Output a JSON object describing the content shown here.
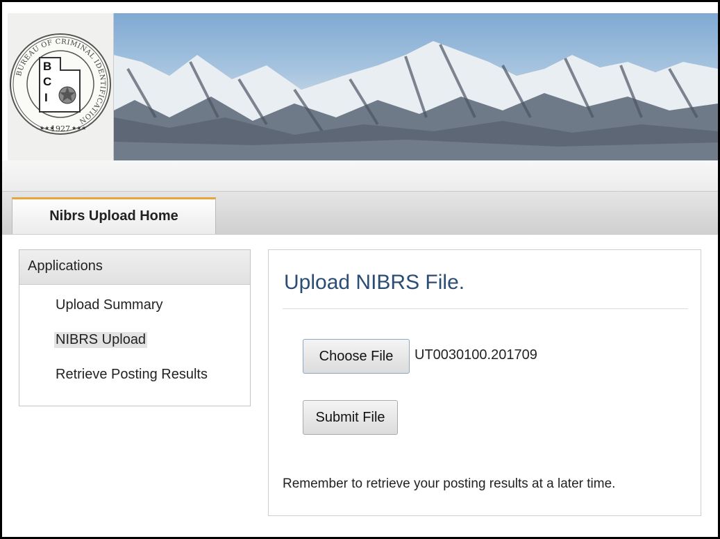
{
  "header": {
    "logo": {
      "icon": "bci-seal-icon",
      "ring_text": "BUREAU OF CRIMINAL IDENTIFICATION",
      "letters": [
        "B",
        "C",
        "I"
      ],
      "year": "1927"
    },
    "banner_icon": "mountain-banner-image"
  },
  "tabs": [
    {
      "label": "Nibrs Upload Home",
      "active": true
    }
  ],
  "sidebar": {
    "header": "Applications",
    "items": [
      {
        "label": "Upload Summary",
        "selected": false
      },
      {
        "label": "NIBRS Upload",
        "selected": true
      },
      {
        "label": "Retrieve Posting Results",
        "selected": false
      }
    ]
  },
  "main": {
    "title": "Upload NIBRS File.",
    "choose_file_label": "Choose File",
    "selected_file": "UT0030100.201709",
    "submit_label": "Submit File",
    "reminder": "Remember to retrieve your posting results at a later time."
  },
  "colors": {
    "title": "#2b4d73",
    "tab_accent": "#e8a33a",
    "choose_border": "#8aa7c8"
  }
}
